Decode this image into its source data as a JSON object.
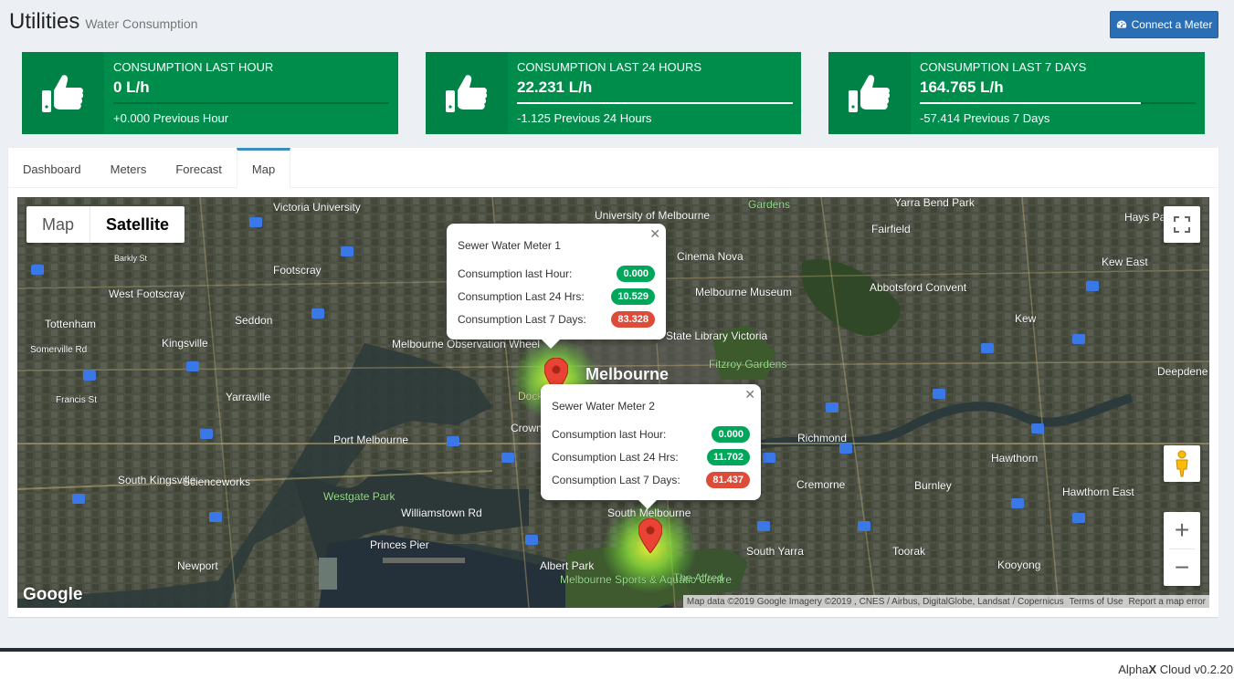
{
  "header": {
    "title": "Utilities",
    "subtitle": "Water Consumption",
    "connect_label": "Connect a Meter"
  },
  "stats": [
    {
      "label": "Consumption Last Hour",
      "value": "0 L/h",
      "desc": "+0.000 Previous Hour",
      "progress": 0
    },
    {
      "label": "Consumption Last 24 Hours",
      "value": "22.231 L/h",
      "desc": "-1.125 Previous 24 Hours",
      "progress": 1.0
    },
    {
      "label": "Consumption Last 7 Days",
      "value": "164.765 L/h",
      "desc": "-57.414 Previous 7 Days",
      "progress": 0.8
    }
  ],
  "tabs": [
    {
      "label": "Dashboard",
      "active": false
    },
    {
      "label": "Meters",
      "active": false
    },
    {
      "label": "Forecast",
      "active": false
    },
    {
      "label": "Map",
      "active": true
    }
  ],
  "map": {
    "type_map": "Map",
    "type_satellite": "Satellite",
    "google": "Google",
    "attribution": "Map data ©2019 Google Imagery ©2019 , CNES / Airbus, DigitalGlobe, Landsat / Copernicus",
    "terms": "Terms of Use",
    "report": "Report a map error",
    "places": [
      "Victoria University",
      "University of Melbourne",
      "Cinema Nova",
      "Gardens",
      "Yarra Bend Park",
      "Fairfield",
      "Hays Padd",
      "Footscray",
      "West Footscray",
      "Seddon",
      "Tottenham",
      "Kingsville",
      "Yarraville",
      "Melbourne Observation Wheel",
      "Melbourne",
      "Fitzroy Gardens",
      "Melbourne Museum",
      "State Library Victoria",
      "Abbotsford Convent",
      "Kew East",
      "Kew",
      "Deepdene",
      "Richmond",
      "Hawthorn",
      "Burnley",
      "Hawthorn East",
      "Cremorne",
      "Port Melbourne",
      "Westgate Park",
      "South Kingsville",
      "Scienceworks",
      "Williamstown Rd",
      "Princes Pier",
      "Albert Park",
      "Melbourne Sports & Aquatic Centre",
      "South Melbourne",
      "The Alfred",
      "South Yarra",
      "Toorak",
      "Kooyong",
      "Newport",
      "Crown",
      "Somerville Rd",
      "Francis St",
      "Docklands",
      "Barkly St"
    ],
    "meters": [
      {
        "name": "Sewer Water Meter 1",
        "rows": [
          {
            "label": "Consumption last Hour:",
            "value": "0.000",
            "color": "#00a65a"
          },
          {
            "label": "Consumption Last 24 Hrs:",
            "value": "10.529",
            "color": "#00a65a"
          },
          {
            "label": "Consumption Last 7 Days:",
            "value": "83.328",
            "color": "#dd4b39"
          }
        ]
      },
      {
        "name": "Sewer Water Meter 2",
        "rows": [
          {
            "label": "Consumption last Hour:",
            "value": "0.000",
            "color": "#00a65a"
          },
          {
            "label": "Consumption Last 24 Hrs:",
            "value": "11.702",
            "color": "#00a65a"
          },
          {
            "label": "Consumption Last 7 Days:",
            "value": "81.437",
            "color": "#dd4b39"
          }
        ]
      }
    ]
  },
  "footer": {
    "brand_a": "Alpha",
    "brand_b": "X",
    "rest": " Cloud v0.2.20"
  }
}
